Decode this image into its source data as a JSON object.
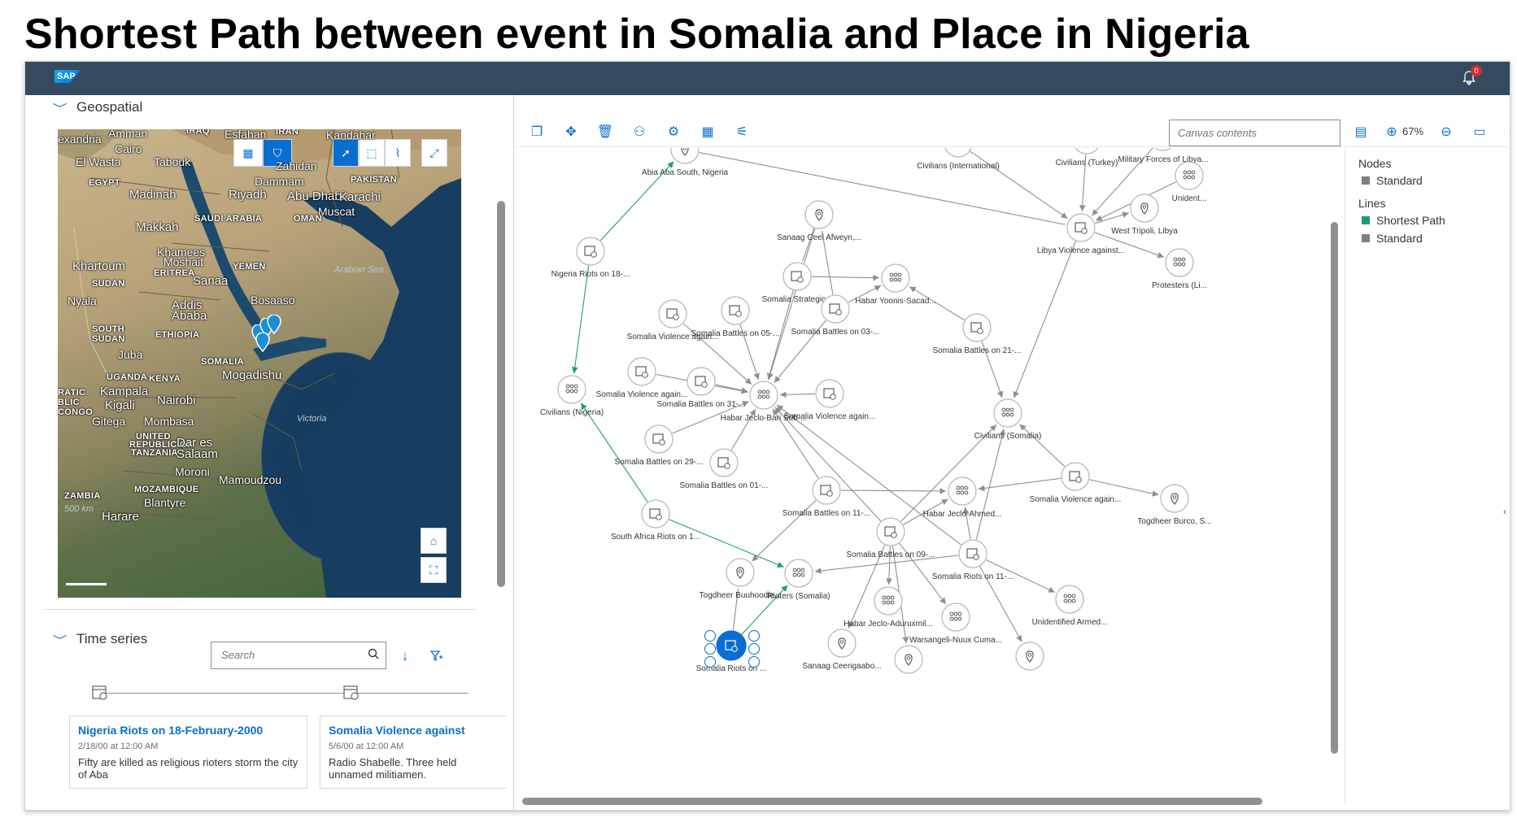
{
  "title": "Shortest Path between event in Somalia and Place in Nigeria",
  "shell": {
    "logo": "SAP",
    "notification_count": "0",
    "icon": "bell-icon"
  },
  "geospatial": {
    "header": "Geospatial",
    "labels": [
      {
        "t": "Amman",
        "k": "city"
      },
      {
        "t": "IRAQ",
        "k": "small"
      },
      {
        "t": "Esfahan",
        "k": "city"
      },
      {
        "t": "IRAN",
        "k": "small"
      },
      {
        "t": "Kandahar",
        "k": "city"
      },
      {
        "t": "exandria",
        "k": "city"
      },
      {
        "t": "Cairo",
        "k": "city"
      },
      {
        "t": "El Wasta",
        "k": "city"
      },
      {
        "t": "Tabouk",
        "k": "city"
      },
      {
        "t": "Zahidan",
        "k": "city"
      },
      {
        "t": "EGYPT",
        "k": "small"
      },
      {
        "t": "Dammam",
        "k": "city"
      },
      {
        "t": "PAKISTAN",
        "k": "small"
      },
      {
        "t": "Madinah",
        "k": "big"
      },
      {
        "t": "Riyadh",
        "k": "big"
      },
      {
        "t": "Abu Dhabi",
        "k": "big"
      },
      {
        "t": "Karachi",
        "k": "big"
      },
      {
        "t": "Muscat",
        "k": "city"
      },
      {
        "t": "SAUDI ARABIA",
        "k": "small"
      },
      {
        "t": "OMAN",
        "k": "small"
      },
      {
        "t": "Makkah",
        "k": "big"
      },
      {
        "t": "Khamees",
        "k": "city"
      },
      {
        "t": "Moshait",
        "k": "city"
      },
      {
        "t": "Khartoum",
        "k": "big"
      },
      {
        "t": "ERITREA",
        "k": "small"
      },
      {
        "t": "YEMEN",
        "k": "small"
      },
      {
        "t": "Arabian Sea",
        "k": "sea-lbl"
      },
      {
        "t": "SUDAN",
        "k": "small"
      },
      {
        "t": "Sanaa",
        "k": "big"
      },
      {
        "t": "Nyala",
        "k": "city"
      },
      {
        "t": "Addis",
        "k": "big"
      },
      {
        "t": "Ababa",
        "k": "big"
      },
      {
        "t": "Bosaaso",
        "k": "city"
      },
      {
        "t": "SOUTH",
        "k": "small"
      },
      {
        "t": "SUDAN",
        "k": "small"
      },
      {
        "t": "ETHIOPIA",
        "k": "small"
      },
      {
        "t": "Juba",
        "k": "city"
      },
      {
        "t": "SOMALIA",
        "k": "small"
      },
      {
        "t": "Mogadishu",
        "k": "big"
      },
      {
        "t": "UGANDA",
        "k": "small"
      },
      {
        "t": "KENYA",
        "k": "small"
      },
      {
        "t": "RATIC",
        "k": "small"
      },
      {
        "t": "BLIC",
        "k": "small"
      },
      {
        "t": "CONGO",
        "k": "small"
      },
      {
        "t": "Kampala",
        "k": "big"
      },
      {
        "t": "Kigali",
        "k": "big"
      },
      {
        "t": "Nairobi",
        "k": "big"
      },
      {
        "t": "Victoria",
        "k": "sea-lbl"
      },
      {
        "t": "Gitega",
        "k": "city"
      },
      {
        "t": "Mombasa",
        "k": "city"
      },
      {
        "t": "UNITED",
        "k": "small"
      },
      {
        "t": "REPUBLIC OF",
        "k": "small"
      },
      {
        "t": "TANZANIA",
        "k": "small"
      },
      {
        "t": "Dar es",
        "k": "big"
      },
      {
        "t": "Salaam",
        "k": "big"
      },
      {
        "t": "Moroni",
        "k": "city"
      },
      {
        "t": "Mamoudzou",
        "k": "city"
      },
      {
        "t": "ZAMBIA",
        "k": "small"
      },
      {
        "t": "MOZAMBIQUE",
        "k": "small"
      },
      {
        "t": "Blantyre",
        "k": "city"
      },
      {
        "t": "Harare",
        "k": "big"
      },
      {
        "t": "500 km",
        "k": "sea-lbl"
      }
    ]
  },
  "time_series": {
    "header": "Time series",
    "search_placeholder": "Search",
    "cards": [
      {
        "title": "Nigeria Riots on 18-February-2000",
        "date": "2/18/00 at 12:00 AM",
        "body": "Fifty are killed as religious rioters storm the city of Aba"
      },
      {
        "title": "Somalia Violence against",
        "date": "5/6/00 at 12:00 AM",
        "body": "Radio Shabelle. Three held unnamed militiamen."
      }
    ]
  },
  "canvas": {
    "search_placeholder": "Canvas contents",
    "zoom": "67%",
    "legend": {
      "nodes_header": "Nodes",
      "nodes": [
        {
          "label": "Standard",
          "color": "#808080"
        }
      ],
      "lines_header": "Lines",
      "lines": [
        {
          "label": "Shortest Path",
          "color": "#1a9e6e"
        },
        {
          "label": "Standard",
          "color": "#808080"
        }
      ]
    }
  },
  "graph": {
    "colors": {
      "path": "#1aa06f",
      "edge": "#8f8f8f",
      "node": "#ffffff",
      "node_border": "#b5b5b5",
      "selected": "#0a6ed1"
    },
    "nodes": [
      {
        "id": "abia",
        "label": "Abia Aba South, Nigeria",
        "type": "place"
      },
      {
        "id": "civint",
        "label": "Civilians (International)",
        "type": "group"
      },
      {
        "id": "civtur",
        "label": "Civilians (Turkey)",
        "type": "group"
      },
      {
        "id": "milforces",
        "label": "Military Forces of Libya...",
        "type": "group"
      },
      {
        "id": "unident",
        "label": "Unident...",
        "type": "group"
      },
      {
        "id": "nigriots",
        "label": "Nigeria Riots on 18-...",
        "type": "event"
      },
      {
        "id": "sanaag1",
        "label": "Sanaag Ceel Afweyn,...",
        "type": "place"
      },
      {
        "id": "libyaviol",
        "label": "Libya Violence against...",
        "type": "event"
      },
      {
        "id": "westtripoli",
        "label": "West Tripoli, Libya",
        "type": "place"
      },
      {
        "id": "protesters",
        "label": "Protesters (Li...",
        "type": "group"
      },
      {
        "id": "somstrat",
        "label": "Somalia Strategic...",
        "type": "event"
      },
      {
        "id": "habaryoonis",
        "label": "Habar Yoonis-Sacad...",
        "type": "group"
      },
      {
        "id": "somviol1",
        "label": "Somalia Violence again...",
        "type": "event"
      },
      {
        "id": "sombat05",
        "label": "Somalia Battles on 05-...",
        "type": "event"
      },
      {
        "id": "sombat03",
        "label": "Somalia Battles on 03-...",
        "type": "event"
      },
      {
        "id": "sombat21",
        "label": "Somalia Battles on 21-...",
        "type": "event"
      },
      {
        "id": "somviol2",
        "label": "Somalia Violence again...",
        "type": "event"
      },
      {
        "id": "sombat31",
        "label": "Somalia Battles on 31-...",
        "type": "event"
      },
      {
        "id": "civnig",
        "label": "Civilians (Nigeria)",
        "type": "group"
      },
      {
        "id": "habarjeclo",
        "label": "Habar Jeclo-Bari Sub-...",
        "type": "group"
      },
      {
        "id": "somviol3",
        "label": "Somalia Violence again...",
        "type": "event"
      },
      {
        "id": "civsom",
        "label": "Civilians (Somalia)",
        "type": "group"
      },
      {
        "id": "sombat29",
        "label": "Somalia Battles on 29-...",
        "type": "event"
      },
      {
        "id": "sombat01",
        "label": "Somalia Battles on 01-...",
        "type": "event"
      },
      {
        "id": "somviol4",
        "label": "Somalia Violence again...",
        "type": "event"
      },
      {
        "id": "sombat11",
        "label": "Somalia Battles on 11-...",
        "type": "event"
      },
      {
        "id": "habarjecloahmed",
        "label": "Habar Jeclo-Ahmed...",
        "type": "group"
      },
      {
        "id": "togburco",
        "label": "Togdheer Burco, S...",
        "type": "place"
      },
      {
        "id": "sariots",
        "label": "South Africa Riots on 1...",
        "type": "event"
      },
      {
        "id": "sombat09",
        "label": "Somalia Battles on 09-...",
        "type": "event"
      },
      {
        "id": "somriots11",
        "label": "Somalia Riots on 11-...",
        "type": "event"
      },
      {
        "id": "togbuuh",
        "label": "Togdheer Buuhoodle...",
        "type": "place"
      },
      {
        "id": "riotsom",
        "label": "Rioters (Somalia)",
        "type": "group"
      },
      {
        "id": "habarjecloadur",
        "label": "Habar Jeclo-Aduruxmil...",
        "type": "group"
      },
      {
        "id": "warsangeli",
        "label": "Warsangeli-Nuux Cuma...",
        "type": "group"
      },
      {
        "id": "unidarmed",
        "label": "Unidentified Armed...",
        "type": "group"
      },
      {
        "id": "sanaag2",
        "label": "Sanaag Ceerigaabo...",
        "type": "place"
      },
      {
        "id": "place1",
        "label": "",
        "type": "place"
      },
      {
        "id": "place2",
        "label": "",
        "type": "place"
      },
      {
        "id": "selected",
        "label": "Somalia Riots on ...",
        "type": "event"
      }
    ]
  }
}
